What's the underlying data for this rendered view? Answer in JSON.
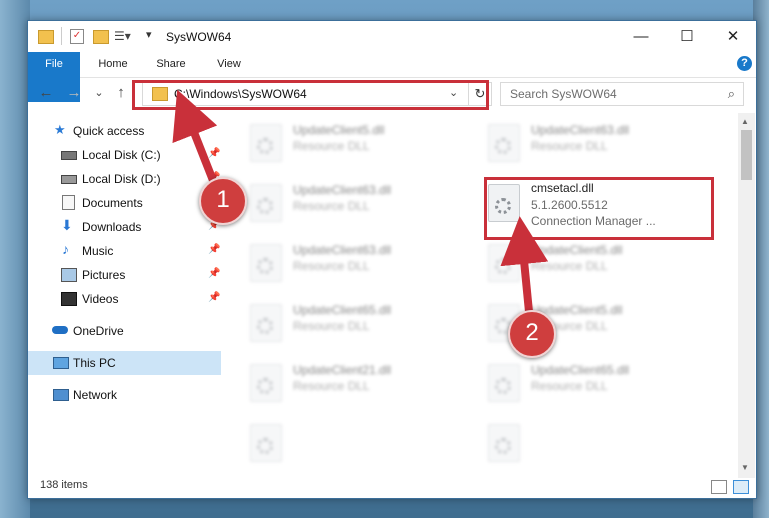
{
  "window": {
    "title": "SysWOW64"
  },
  "controls": {
    "minimize": "—",
    "maximize": "☐",
    "close": "✕"
  },
  "ribbon": {
    "tabs": [
      "File",
      "Home",
      "Share",
      "View"
    ],
    "help": "?"
  },
  "nav": {
    "back": "←",
    "forward": "→",
    "recent": "⌄",
    "up": "↑",
    "refresh": "↻",
    "dropdown": "⌄"
  },
  "address": {
    "path": "C:\\Windows\\SysWOW64"
  },
  "search": {
    "placeholder": "Search SysWOW64",
    "icon": "search-icon"
  },
  "sidebar": {
    "items": [
      {
        "label": "Quick access",
        "icon": "star-icon"
      },
      {
        "label": "Local Disk (C:)",
        "icon": "drive-icon"
      },
      {
        "label": "Local Disk (D:)",
        "icon": "drive-icon"
      },
      {
        "label": "Documents",
        "icon": "documents-icon"
      },
      {
        "label": "Downloads",
        "icon": "download-icon"
      },
      {
        "label": "Music",
        "icon": "music-icon"
      },
      {
        "label": "Pictures",
        "icon": "pictures-icon"
      },
      {
        "label": "Videos",
        "icon": "videos-icon"
      },
      {
        "label": "OneDrive",
        "icon": "cloud-icon"
      },
      {
        "label": "This PC",
        "icon": "computer-icon"
      },
      {
        "label": "Network",
        "icon": "network-icon"
      }
    ],
    "pin": "📌"
  },
  "files": [
    {
      "name": "UpdateClient5.dll",
      "type": "Resource DLL"
    },
    {
      "name": "UpdateClient63.dll",
      "type": "Resource DLL"
    },
    {
      "name": "UpdateClient63.dll",
      "type": "Resource DLL"
    },
    {
      "name": "cmsetacl.dll",
      "version": "5.1.2600.5512",
      "type": "Connection Manager ..."
    },
    {
      "name": "UpdateClient63.dll",
      "type": "Resource DLL"
    },
    {
      "name": "UpdateClient5.dll",
      "type": "Resource DLL"
    },
    {
      "name": "UpdateClient65.dll",
      "type": "Resource DLL"
    },
    {
      "name": "UpdateClient5.dll",
      "type": "Resource DLL"
    },
    {
      "name": "UpdateClient21.dll",
      "type": "Resource DLL"
    },
    {
      "name": "UpdateClient65.dll",
      "type": "Resource DLL"
    }
  ],
  "status": {
    "count": "138 items"
  },
  "annotations": {
    "step1": "1",
    "step2": "2",
    "color": "#c9303a"
  }
}
